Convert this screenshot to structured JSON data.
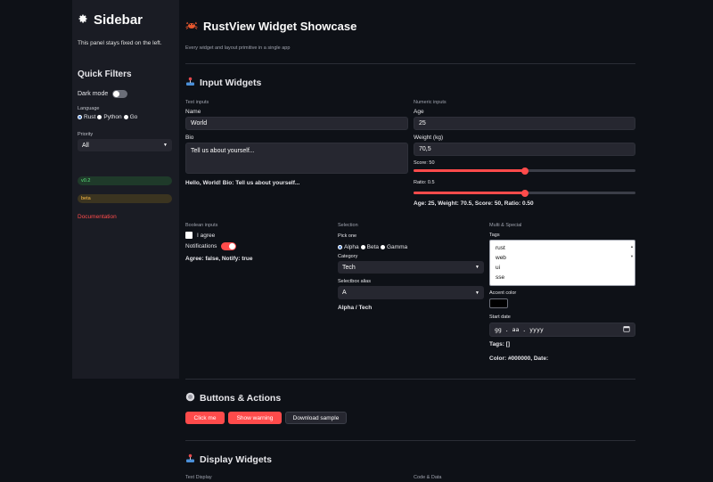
{
  "sidebar": {
    "title": "Sidebar",
    "title_icon": "gear-icon",
    "note": "This panel stays fixed on the left.",
    "quick_filters_title": "Quick Filters",
    "dark_mode_label": "Dark mode",
    "dark_mode_on": false,
    "language_label": "Language",
    "language_options": [
      "Rust",
      "Python",
      "Go"
    ],
    "language_selected": "Rust",
    "priority_label": "Priority",
    "priority_value": "All",
    "version_badge": "v0.2",
    "beta_badge": "beta",
    "doc_link": "Documentation"
  },
  "header": {
    "title": "RustView Widget Showcase",
    "title_icon": "crab-icon",
    "subtitle": "Every widget and layout primitive in a single app"
  },
  "input_widgets": {
    "title": "Input Widgets",
    "title_icon": "joystick-icon",
    "text_inputs": {
      "group_label": "Text inputs",
      "name_label": "Name",
      "name_value": "World",
      "bio_label": "Bio",
      "bio_value": "Tell us about yourself...",
      "output": "Hello, World! Bio: Tell us about yourself..."
    },
    "numeric_inputs": {
      "group_label": "Numeric inputs",
      "age_label": "Age",
      "age_value": "25",
      "weight_label": "Weight (kg)",
      "weight_value": "70,5",
      "score_label": "Score: 50",
      "score_fraction": 0.5,
      "ratio_label": "Ratio: 0.5",
      "ratio_fraction": 0.5,
      "output": "Age: 25, Weight: 70.5, Score: 50, Ratio: 0.50"
    },
    "boolean_inputs": {
      "group_label": "Boolean inputs",
      "agree_label": "I agree",
      "notifications_label": "Notifications",
      "notifications_on": true,
      "output": "Agree: false, Notify: true"
    },
    "selection": {
      "group_label": "Selection",
      "pick_one_label": "Pick one",
      "pick_options": [
        "Alpha",
        "Beta",
        "Gamma"
      ],
      "pick_selected": "Alpha",
      "category_label": "Category",
      "category_value": "Tech",
      "alias_label": "Selectbox alias",
      "alias_value": "A",
      "output": "Alpha / Tech"
    },
    "multi_special": {
      "group_label": "Multi & Special",
      "tags_label": "Tags",
      "tags_options": [
        "rust",
        "web",
        "ui",
        "sse"
      ],
      "accent_color_label": "Accent color",
      "accent_color_value": "#000000",
      "start_date_label": "Start date",
      "start_date_placeholder": "gg . aa . yyyy",
      "tags_output": "Tags: []",
      "color_output": "Color: #000000, Date:"
    }
  },
  "buttons_actions": {
    "title": "Buttons & Actions",
    "title_icon": "radio-button-icon",
    "click_me": "Click me",
    "show_warning": "Show warning",
    "download_sample": "Download sample"
  },
  "display_widgets": {
    "title": "Display Widgets",
    "title_icon": "joystick-icon",
    "text_display_label": "Text Display",
    "code_data_label": "Code & Data"
  },
  "colors": {
    "accent": "#ff4b4b",
    "background": "#0e1117",
    "sidebar": "#1a1c24",
    "input": "#262730"
  }
}
